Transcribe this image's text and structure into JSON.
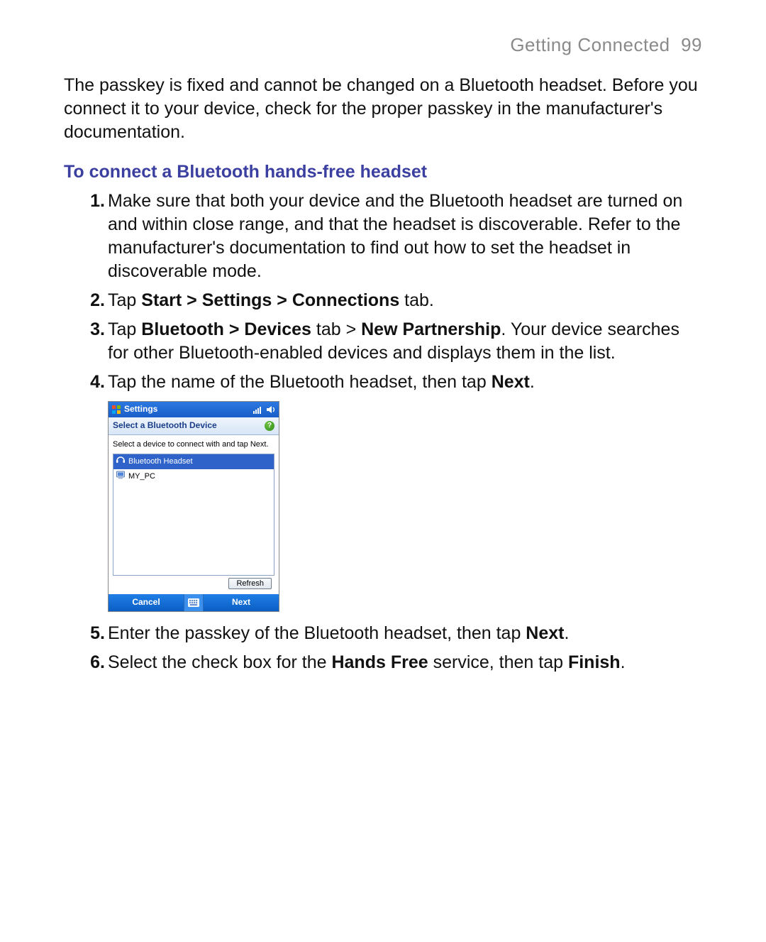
{
  "running_head": {
    "title": "Getting Connected",
    "page_number": "99"
  },
  "intro_paragraph": "The passkey is fixed and cannot be changed on a Bluetooth headset. Before you connect it to your device, check for the proper passkey in the manufacturer's documentation.",
  "section_heading": "To connect a Bluetooth hands-free headset",
  "steps": {
    "s1": "Make sure that both your device and the Bluetooth headset are turned on and within close range, and that the headset is discoverable. Refer to the manufacturer's documentation to find out how to set the headset in discoverable mode.",
    "s2_pre": "Tap ",
    "s2_bold": "Start > Settings > Connections",
    "s2_post": " tab.",
    "s3_pre": "Tap ",
    "s3_b1": "Bluetooth > Devices",
    "s3_mid1": " tab > ",
    "s3_b2": "New Partnership",
    "s3_post": ". Your device searches for other Bluetooth-enabled devices and displays them in the list.",
    "s4_pre": "Tap the name of the Bluetooth headset, then tap ",
    "s4_bold": "Next",
    "s4_post": ".",
    "s5_pre": "Enter the passkey of the Bluetooth headset, then tap ",
    "s5_bold": "Next",
    "s5_post": ".",
    "s6_pre": "Select the check box for the ",
    "s6_b1": "Hands Free",
    "s6_mid": " service, then tap ",
    "s6_b2": "Finish",
    "s6_post": "."
  },
  "wm": {
    "top_title": "Settings",
    "header_title": "Select a Bluetooth Device",
    "help_glyph": "?",
    "instruction": "Select a device to connect with and tap Next.",
    "items": {
      "i0": "Bluetooth Headset",
      "i1": "MY_PC"
    },
    "refresh": "Refresh",
    "soft_left": "Cancel",
    "soft_right": "Next"
  }
}
